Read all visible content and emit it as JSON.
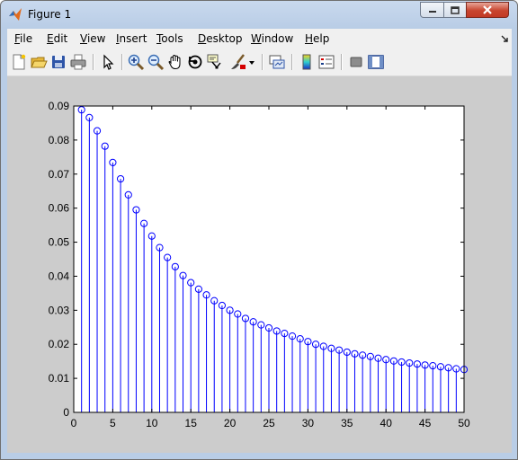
{
  "window": {
    "title": "Figure 1",
    "icon": "matlab-logo-icon",
    "controls": [
      "minimize-icon",
      "maximize-icon",
      "close-icon"
    ]
  },
  "menu": {
    "items": [
      {
        "label": "File",
        "u": "F",
        "rest": "ile"
      },
      {
        "label": "Edit",
        "u": "E",
        "rest": "dit"
      },
      {
        "label": "View",
        "u": "V",
        "rest": "iew"
      },
      {
        "label": "Insert",
        "u": "I",
        "rest": "nsert"
      },
      {
        "label": "Tools",
        "u": "T",
        "rest": "ools"
      },
      {
        "label": "Desktop",
        "u": "D",
        "rest": "esktop"
      },
      {
        "label": "Window",
        "u": "W",
        "rest": "indow"
      },
      {
        "label": "Help",
        "u": "H",
        "rest": "elp"
      }
    ]
  },
  "toolbar": {
    "buttons": [
      "new-figure-icon",
      "open-file-icon",
      "save-icon",
      "print-icon",
      "edit-plot-icon",
      "zoom-in-icon",
      "zoom-out-icon",
      "pan-icon",
      "rotate-3d-icon",
      "data-cursor-icon",
      "brush-icon",
      "link-plot-icon",
      "colorbar-icon",
      "legend-icon",
      "hide-plot-tools-icon",
      "show-plot-tools-icon"
    ]
  },
  "chart_data": {
    "type": "stem",
    "title": "",
    "xlabel": "",
    "ylabel": "",
    "xlim": [
      0,
      50
    ],
    "ylim": [
      0,
      0.09
    ],
    "xticks": [
      0,
      5,
      10,
      15,
      20,
      25,
      30,
      35,
      40,
      45,
      50
    ],
    "yticks": [
      0,
      0.01,
      0.02,
      0.03,
      0.04,
      0.05,
      0.06,
      0.07,
      0.08,
      0.09
    ],
    "xtick_labels": [
      "0",
      "5",
      "10",
      "15",
      "20",
      "25",
      "30",
      "35",
      "40",
      "45",
      "50"
    ],
    "ytick_labels": [
      "0",
      "0.01",
      "0.02",
      "0.03",
      "0.04",
      "0.05",
      "0.06",
      "0.07",
      "0.08",
      "0.09"
    ],
    "grid": false,
    "color": "#0000ff",
    "marker": "open-circle",
    "x": [
      1,
      2,
      3,
      4,
      5,
      6,
      7,
      8,
      9,
      10,
      11,
      12,
      13,
      14,
      15,
      16,
      17,
      18,
      19,
      20,
      21,
      22,
      23,
      24,
      25,
      26,
      27,
      28,
      29,
      30,
      31,
      32,
      33,
      34,
      35,
      36,
      37,
      38,
      39,
      40,
      41,
      42,
      43,
      44,
      45,
      46,
      47,
      48,
      49,
      50
    ],
    "values": [
      0.0889,
      0.0866,
      0.0827,
      0.0782,
      0.0734,
      0.0686,
      0.0639,
      0.0595,
      0.0555,
      0.0518,
      0.0484,
      0.0455,
      0.0428,
      0.0402,
      0.0381,
      0.0362,
      0.0345,
      0.0328,
      0.0314,
      0.03,
      0.0289,
      0.0276,
      0.0266,
      0.0257,
      0.0248,
      0.0239,
      0.0232,
      0.0224,
      0.0216,
      0.0208,
      0.02,
      0.0194,
      0.0188,
      0.0183,
      0.0177,
      0.0172,
      0.0168,
      0.0164,
      0.0159,
      0.0155,
      0.0151,
      0.0148,
      0.0145,
      0.0142,
      0.0139,
      0.0137,
      0.0134,
      0.0131,
      0.0128,
      0.0126
    ]
  }
}
